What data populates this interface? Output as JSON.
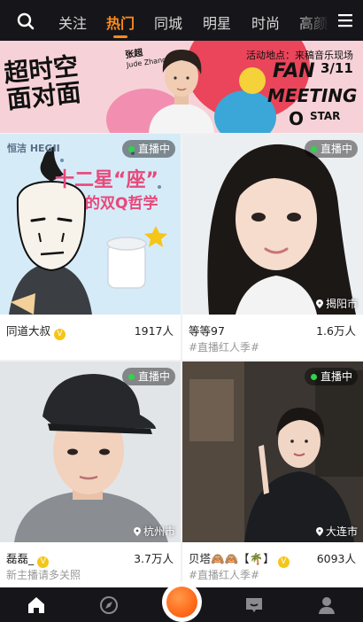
{
  "nav": {
    "tabs": [
      "关注",
      "热门",
      "同城",
      "明星",
      "时尚",
      "高颜"
    ],
    "active_tab": "热门",
    "accent": "#ff8a1d",
    "icons": [
      "search-icon",
      "menu-icon"
    ]
  },
  "banner": {
    "title_line1": "超时空",
    "title_line2": "面对面",
    "star_name": "张超",
    "star_name_en": "Jude Zhang",
    "promo": "活动地点：来稿音乐现场",
    "fan": "FAN",
    "date": "3/11",
    "meeting": "MEETING",
    "brand": "STAR"
  },
  "cards": [
    {
      "live_label": "直播中",
      "brand": "恒洁 HEGII",
      "headline_1": "十二星“座”",
      "headline_2": "的双Q哲学",
      "name": "同道大叔",
      "verified": true,
      "viewers": "1917人",
      "subtitle": ""
    },
    {
      "live_label": "直播中",
      "location": "揭阳市",
      "name": "等等97",
      "verified": false,
      "viewers": "1.6万人",
      "subtitle": "#直播红人季#"
    },
    {
      "live_label": "直播中",
      "location": "杭州市",
      "name": "磊磊_",
      "verified": true,
      "viewers": "3.7万人",
      "subtitle": "新主播请多关照"
    },
    {
      "live_label": "直播中",
      "location": "大连市",
      "name": "贝塔🙈🙈【🌴】",
      "verified": true,
      "viewers": "6093人",
      "subtitle": "#直播红人季#"
    }
  ],
  "bottom_nav": {
    "icons": [
      "home-icon",
      "compass-icon",
      "record-button",
      "message-icon",
      "profile-icon"
    ],
    "active": "home-icon"
  }
}
